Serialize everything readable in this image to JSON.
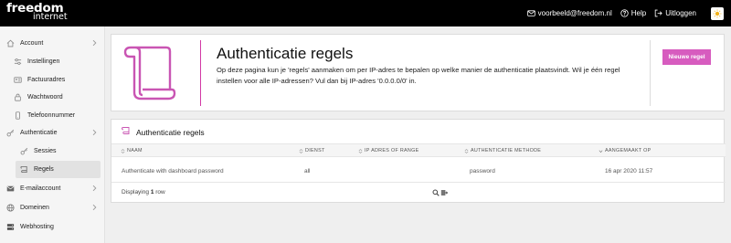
{
  "header": {
    "logo_line1": "freedom",
    "logo_line2": "internet",
    "email": "voorbeeld@freedom.nl",
    "help": "Help",
    "logout": "Uitloggen"
  },
  "sidebar": {
    "items": [
      {
        "label": "Account",
        "icon": "home-icon"
      },
      {
        "label": "Instellingen",
        "icon": "settings-icon"
      },
      {
        "label": "Factuuradres",
        "icon": "address-card-icon"
      },
      {
        "label": "Wachtwoord",
        "icon": "lock-icon"
      },
      {
        "label": "Telefoonnummer",
        "icon": "phone-icon"
      },
      {
        "label": "Authenticatie",
        "icon": "key-icon"
      },
      {
        "label": "Sessies",
        "icon": "key-icon"
      },
      {
        "label": "Regels",
        "icon": "scroll-icon"
      },
      {
        "label": "E-mailaccount",
        "icon": "envelope-icon"
      },
      {
        "label": "Domeinen",
        "icon": "globe-icon"
      },
      {
        "label": "Webhosting",
        "icon": "server-icon"
      }
    ]
  },
  "hero": {
    "title": "Authenticatie regels",
    "text": "Op deze pagina kun je 'regels' aanmaken om per IP-adres te bepalen op welke manier de authenticatie plaatsvindt. Wil je één regel instellen voor alle IP-adressen? Vul dan bij IP-adres '0.0.0.0/0' in.",
    "button": "Nieuwe regel"
  },
  "table": {
    "title": "Authenticatie regels",
    "columns": [
      "NAAM",
      "DIENST",
      "IP ADRES OF RANGE",
      "AUTHENTICATIE METHODE",
      "AANGEMAAKT OP"
    ],
    "rows": [
      [
        "Authenticate with dashboard password",
        "all",
        "",
        "password",
        "16 apr 2020 11:57"
      ]
    ],
    "footer_prefix": "Displaying",
    "footer_count": "1",
    "footer_suffix": "row"
  },
  "colors": {
    "accent": "#d75cbf",
    "topbar": "#000000"
  }
}
